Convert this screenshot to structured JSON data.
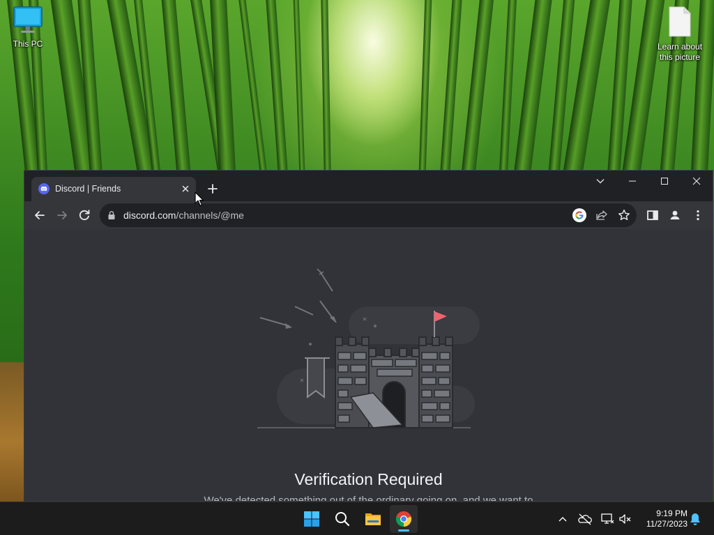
{
  "desktop": {
    "icons": [
      {
        "label": "This PC",
        "icon": "monitor-icon"
      },
      {
        "label": "Learn about this picture",
        "icon": "document-icon"
      }
    ]
  },
  "browser": {
    "tab": {
      "title": "Discord | Friends",
      "favicon": "discord-icon"
    },
    "address": {
      "host": "discord.com",
      "path": "/channels/@me"
    },
    "colors": {
      "frame": "#202124",
      "toolbar": "#35363a",
      "page": "#313338",
      "flag": "#f0646e"
    }
  },
  "page": {
    "heading": "Verification Required",
    "subtext": "We've detected something out of the ordinary going on, and we want to"
  },
  "taskbar": {
    "apps": [
      "start-icon",
      "search-icon",
      "file-explorer-icon",
      "chrome-icon"
    ],
    "time": "9:19 PM",
    "date": "11/27/2023",
    "accent": "#4cc2ff"
  }
}
